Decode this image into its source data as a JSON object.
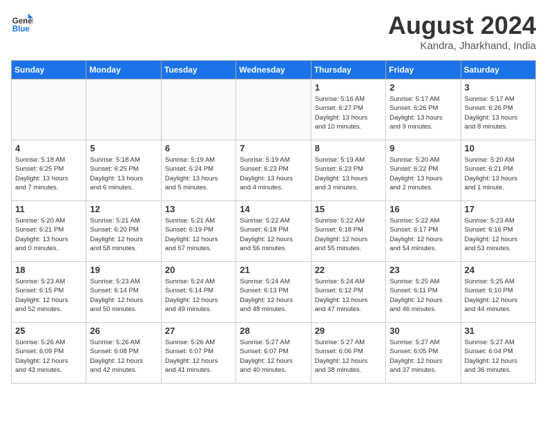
{
  "header": {
    "logo_line1": "General",
    "logo_line2": "Blue",
    "month_year": "August 2024",
    "location": "Kandra, Jharkhand, India"
  },
  "days_of_week": [
    "Sunday",
    "Monday",
    "Tuesday",
    "Wednesday",
    "Thursday",
    "Friday",
    "Saturday"
  ],
  "weeks": [
    [
      {
        "day": "",
        "info": ""
      },
      {
        "day": "",
        "info": ""
      },
      {
        "day": "",
        "info": ""
      },
      {
        "day": "",
        "info": ""
      },
      {
        "day": "1",
        "info": "Sunrise: 5:16 AM\nSunset: 6:27 PM\nDaylight: 13 hours\nand 10 minutes."
      },
      {
        "day": "2",
        "info": "Sunrise: 5:17 AM\nSunset: 6:26 PM\nDaylight: 13 hours\nand 9 minutes."
      },
      {
        "day": "3",
        "info": "Sunrise: 5:17 AM\nSunset: 6:26 PM\nDaylight: 13 hours\nand 8 minutes."
      }
    ],
    [
      {
        "day": "4",
        "info": "Sunrise: 5:18 AM\nSunset: 6:25 PM\nDaylight: 13 hours\nand 7 minutes."
      },
      {
        "day": "5",
        "info": "Sunrise: 5:18 AM\nSunset: 6:25 PM\nDaylight: 13 hours\nand 6 minutes."
      },
      {
        "day": "6",
        "info": "Sunrise: 5:19 AM\nSunset: 6:24 PM\nDaylight: 13 hours\nand 5 minutes."
      },
      {
        "day": "7",
        "info": "Sunrise: 5:19 AM\nSunset: 6:23 PM\nDaylight: 13 hours\nand 4 minutes."
      },
      {
        "day": "8",
        "info": "Sunrise: 5:19 AM\nSunset: 6:23 PM\nDaylight: 13 hours\nand 3 minutes."
      },
      {
        "day": "9",
        "info": "Sunrise: 5:20 AM\nSunset: 6:22 PM\nDaylight: 13 hours\nand 2 minutes."
      },
      {
        "day": "10",
        "info": "Sunrise: 5:20 AM\nSunset: 6:21 PM\nDaylight: 13 hours\nand 1 minute."
      }
    ],
    [
      {
        "day": "11",
        "info": "Sunrise: 5:20 AM\nSunset: 6:21 PM\nDaylight: 13 hours\nand 0 minutes."
      },
      {
        "day": "12",
        "info": "Sunrise: 5:21 AM\nSunset: 6:20 PM\nDaylight: 12 hours\nand 58 minutes."
      },
      {
        "day": "13",
        "info": "Sunrise: 5:21 AM\nSunset: 6:19 PM\nDaylight: 12 hours\nand 57 minutes."
      },
      {
        "day": "14",
        "info": "Sunrise: 5:22 AM\nSunset: 6:18 PM\nDaylight: 12 hours\nand 56 minutes."
      },
      {
        "day": "15",
        "info": "Sunrise: 5:22 AM\nSunset: 6:18 PM\nDaylight: 12 hours\nand 55 minutes."
      },
      {
        "day": "16",
        "info": "Sunrise: 5:22 AM\nSunset: 6:17 PM\nDaylight: 12 hours\nand 54 minutes."
      },
      {
        "day": "17",
        "info": "Sunrise: 5:23 AM\nSunset: 6:16 PM\nDaylight: 12 hours\nand 53 minutes."
      }
    ],
    [
      {
        "day": "18",
        "info": "Sunrise: 5:23 AM\nSunset: 6:15 PM\nDaylight: 12 hours\nand 52 minutes."
      },
      {
        "day": "19",
        "info": "Sunrise: 5:23 AM\nSunset: 6:14 PM\nDaylight: 12 hours\nand 50 minutes."
      },
      {
        "day": "20",
        "info": "Sunrise: 5:24 AM\nSunset: 6:14 PM\nDaylight: 12 hours\nand 49 minutes."
      },
      {
        "day": "21",
        "info": "Sunrise: 5:24 AM\nSunset: 6:13 PM\nDaylight: 12 hours\nand 48 minutes."
      },
      {
        "day": "22",
        "info": "Sunrise: 5:24 AM\nSunset: 6:12 PM\nDaylight: 12 hours\nand 47 minutes."
      },
      {
        "day": "23",
        "info": "Sunrise: 5:25 AM\nSunset: 6:11 PM\nDaylight: 12 hours\nand 46 minutes."
      },
      {
        "day": "24",
        "info": "Sunrise: 5:25 AM\nSunset: 6:10 PM\nDaylight: 12 hours\nand 44 minutes."
      }
    ],
    [
      {
        "day": "25",
        "info": "Sunrise: 5:26 AM\nSunset: 6:09 PM\nDaylight: 12 hours\nand 43 minutes."
      },
      {
        "day": "26",
        "info": "Sunrise: 5:26 AM\nSunset: 6:08 PM\nDaylight: 12 hours\nand 42 minutes."
      },
      {
        "day": "27",
        "info": "Sunrise: 5:26 AM\nSunset: 6:07 PM\nDaylight: 12 hours\nand 41 minutes."
      },
      {
        "day": "28",
        "info": "Sunrise: 5:27 AM\nSunset: 6:07 PM\nDaylight: 12 hours\nand 40 minutes."
      },
      {
        "day": "29",
        "info": "Sunrise: 5:27 AM\nSunset: 6:06 PM\nDaylight: 12 hours\nand 38 minutes."
      },
      {
        "day": "30",
        "info": "Sunrise: 5:27 AM\nSunset: 6:05 PM\nDaylight: 12 hours\nand 37 minutes."
      },
      {
        "day": "31",
        "info": "Sunrise: 5:27 AM\nSunset: 6:04 PM\nDaylight: 12 hours\nand 36 minutes."
      }
    ]
  ]
}
